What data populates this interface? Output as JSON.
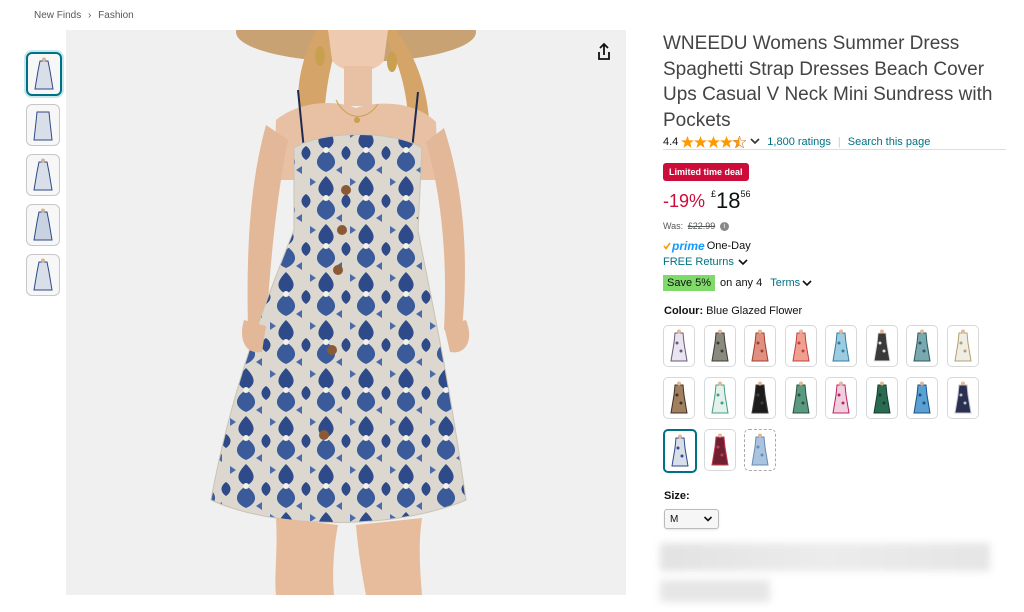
{
  "breadcrumb": {
    "items": [
      "New Finds",
      "Fashion"
    ],
    "separator": "›"
  },
  "gallery": {
    "thumbnail_count": 5,
    "selected_index": 0
  },
  "product": {
    "title": "WNEEDU Womens Summer Dress Spaghetti Strap Dresses Beach Cover Ups Casual V Neck Mini Sundress with Pockets",
    "rating": "4.4",
    "rating_value": 4.4,
    "ratings_link": "1,800 ratings",
    "search_link": "Search this page",
    "deal_badge": "Limited time deal",
    "discount": "-19%",
    "currency": "£",
    "price_whole": "18",
    "price_fraction": "56",
    "was_label": "Was:",
    "was_price": "£22.99",
    "prime_label": "prime",
    "prime_delivery": "One-Day",
    "free_returns": "FREE Returns",
    "save_badge": "Save 5%",
    "save_text": "on any 4",
    "terms_link": "Terms",
    "colour_label": "Colour:",
    "colour_value": "Blue Glazed Flower",
    "size_label": "Size:",
    "size_value": "M"
  },
  "colour_swatches": [
    {
      "name": "white-floral",
      "color": "#e8e4f0",
      "accent": "#6a5a7a"
    },
    {
      "name": "grey-print",
      "color": "#8a8a7e",
      "accent": "#3c3c30"
    },
    {
      "name": "coral-print",
      "color": "#e09080",
      "accent": "#a04030"
    },
    {
      "name": "red-stripe",
      "color": "#f0a090",
      "accent": "#c04040"
    },
    {
      "name": "blue-leaf",
      "color": "#9ccce0",
      "accent": "#3a7aa0"
    },
    {
      "name": "black-white",
      "color": "#3a3a3a",
      "accent": "#e0e0e0"
    },
    {
      "name": "teal-print",
      "color": "#7aa8b0",
      "accent": "#2a5a60"
    },
    {
      "name": "cream-floral",
      "color": "#f0eee4",
      "accent": "#b0a070"
    },
    {
      "name": "brown-leopard",
      "color": "#a08060",
      "accent": "#403020"
    },
    {
      "name": "mint-floral",
      "color": "#e4f0ec",
      "accent": "#40a080"
    },
    {
      "name": "black",
      "color": "#1c1c1c",
      "accent": "#404040"
    },
    {
      "name": "green-print",
      "color": "#5a9a80",
      "accent": "#2a5040"
    },
    {
      "name": "pink-floral",
      "color": "#f0d0e0",
      "accent": "#c02060"
    },
    {
      "name": "dark-green",
      "color": "#2a6a50",
      "accent": "#183c30"
    },
    {
      "name": "blue-floral",
      "color": "#5aa0d0",
      "accent": "#1a508a"
    },
    {
      "name": "navy",
      "color": "#2a3050",
      "accent": "#c0c0d0"
    },
    {
      "name": "blue-glazed-flower",
      "color": "#d8dfe8",
      "accent": "#2e4a88"
    },
    {
      "name": "burgundy",
      "color": "#702030",
      "accent": "#c04050"
    },
    {
      "name": "light-blue",
      "color": "#a8c4e0",
      "accent": "#6a8ab0"
    }
  ],
  "colors": {
    "link": "#007185",
    "deal": "#cc0c39",
    "star": "#ff9900",
    "save": "#7fda69",
    "prime": "#1399ff"
  }
}
